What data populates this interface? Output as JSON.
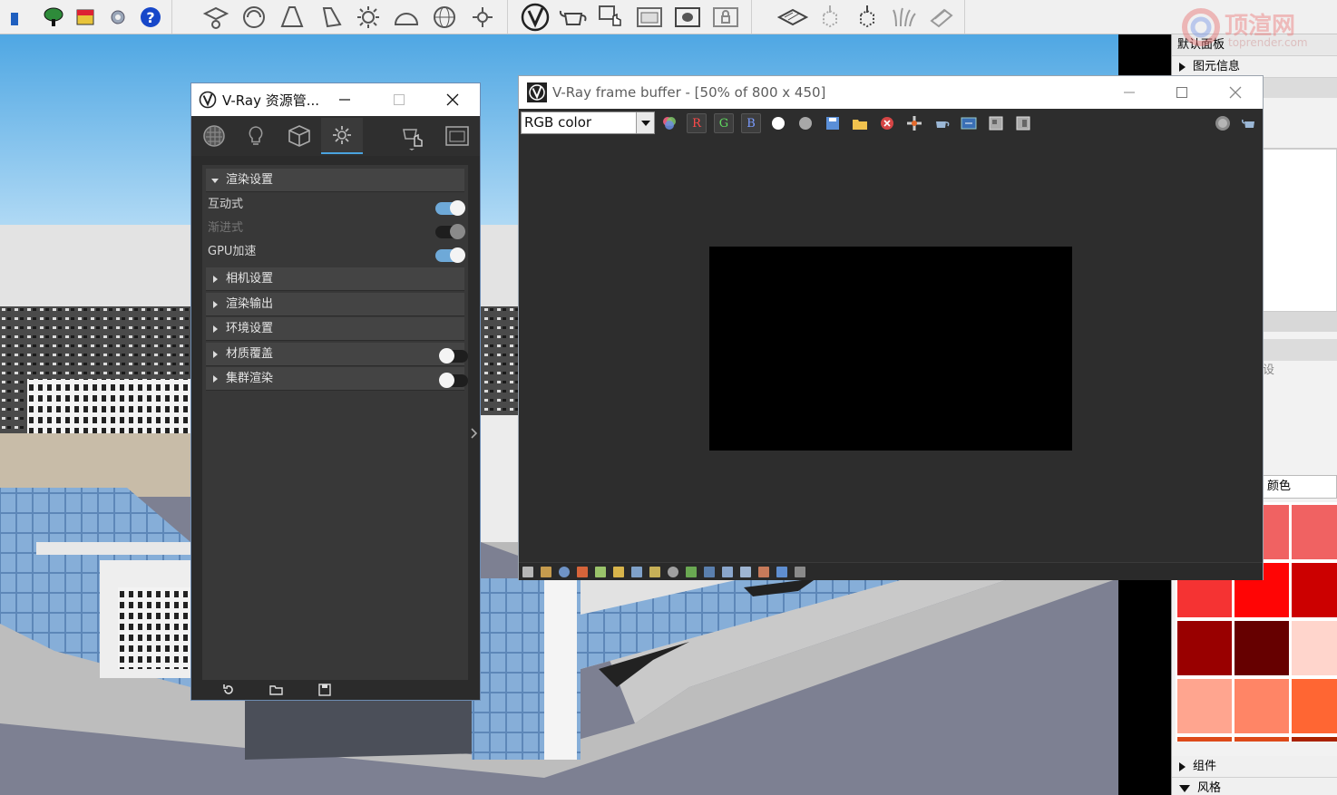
{
  "toolbar": {
    "groups": [
      {
        "name": "standard",
        "icons": [
          "layer-icon",
          "tree-icon",
          "extension-icon",
          "gear-icon",
          "help-icon"
        ]
      },
      {
        "name": "vray-lights",
        "icons": [
          "graduation-icon",
          "sphere-icon",
          "cone-light-icon",
          "spot-light-icon",
          "sun-light-icon",
          "dome-light-icon",
          "globe-light-icon",
          "omni-light-icon"
        ]
      },
      {
        "name": "vray-main",
        "icons": [
          "vray-logo-icon",
          "teapot-icon",
          "interactive-render-icon",
          "frame-buffer-icon",
          "render-region-icon",
          "lock-icon"
        ]
      },
      {
        "name": "vray-objects",
        "icons": [
          "plane-icon",
          "proxy-import-icon",
          "proxy-export-icon",
          "fur-icon",
          "mesh-clipper-icon"
        ]
      }
    ]
  },
  "tray": {
    "title": "默认面板",
    "entity_info": "图元信息",
    "settings_partial": "设",
    "color_label_partial": "颜色",
    "components": "组件",
    "styles": "风格",
    "colors": [
      "#f99a9a",
      "#f06262",
      "#f53333",
      "#ff0505",
      "#cc0000",
      "#990000",
      "#660000",
      "#ffd5cc",
      "#ffa58f",
      "#ff8566",
      "#ff6633",
      "#dd4a1a"
    ]
  },
  "watermark": {
    "text": "顶渲网",
    "url": "toprender.com"
  },
  "asset_editor": {
    "title": "V-Ray 资源管...",
    "tabs": [
      "materials-tab",
      "lights-tab",
      "geometry-tab",
      "settings-tab"
    ],
    "sections": {
      "render_settings": "渲染设置",
      "interactive": "互动式",
      "progressive": "渐进式",
      "gpu": "GPU加速",
      "camera": "相机设置",
      "render_output": "渲染输出",
      "environment": "环境设置",
      "material_override": "材质覆盖",
      "swarm": "集群渲染"
    }
  },
  "frame_buffer": {
    "title": "V-Ray frame buffer - [50% of 800 x 450]",
    "channel": "RGB color",
    "r": "R",
    "g": "G",
    "b": "B"
  }
}
